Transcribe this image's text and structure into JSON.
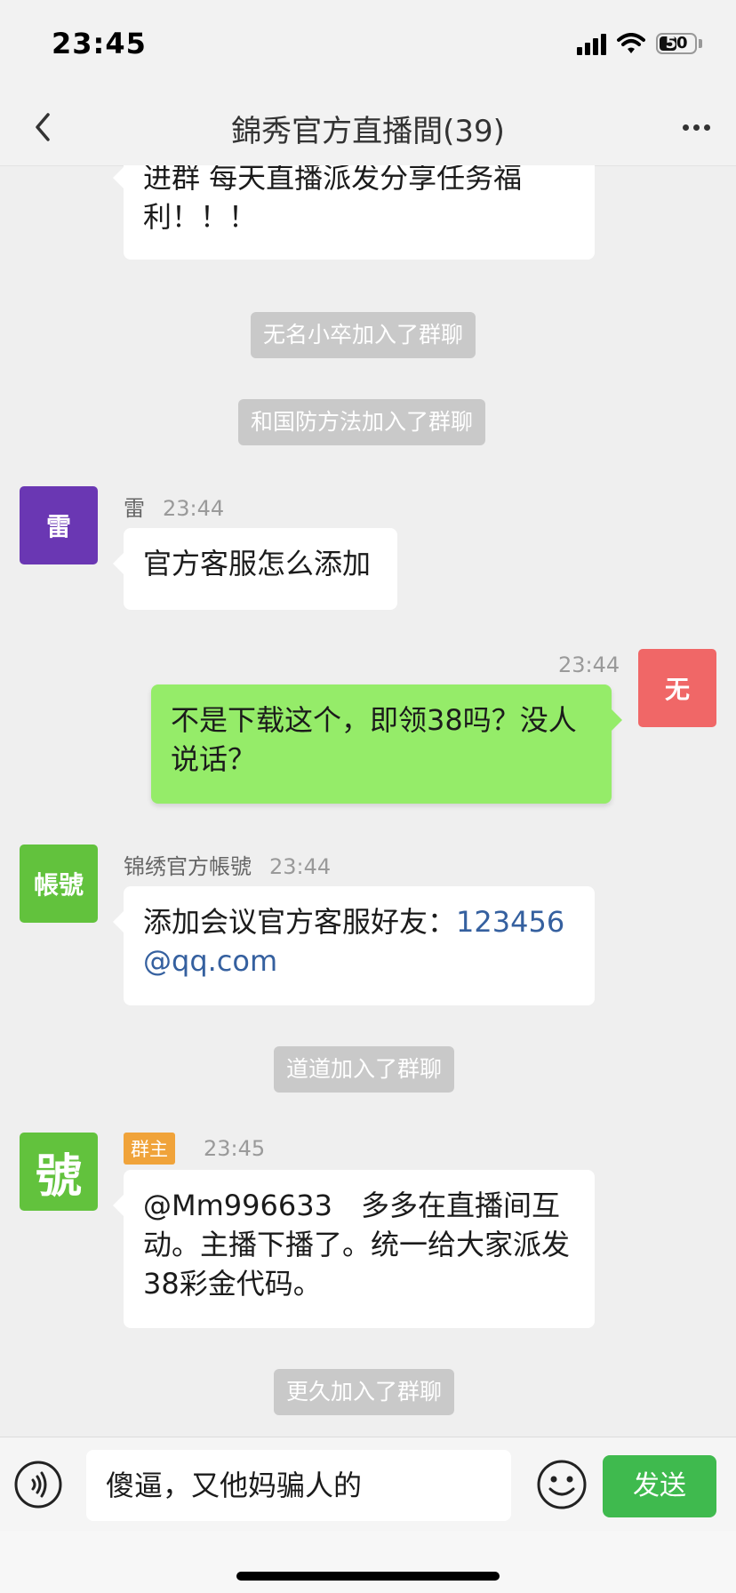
{
  "status_bar": {
    "time": "23:45",
    "battery": "50",
    "battery_level": 0.5
  },
  "nav": {
    "title": "錦秀官方直播間(39)"
  },
  "messages": {
    "m0": {
      "text": "进群 每天直播派发分享任务福利！！！"
    },
    "sys1": "无名小卒加入了群聊",
    "sys2": "和国防方法加入了群聊",
    "m1": {
      "avatar": "雷",
      "avatar_color": "#6a37b3",
      "sender": "雷",
      "time": "23:44",
      "text": "官方客服怎么添加"
    },
    "m2": {
      "avatar": "无",
      "avatar_color": "#f06767",
      "time": "23:44",
      "text": "不是下载这个，即领38吗？没人说话？"
    },
    "m3": {
      "avatar": "帳號",
      "avatar_color": "#62c23d",
      "sender": "锦绣官方帳號",
      "time": "23:44",
      "text": "添加会议官方客服好友：",
      "link": "123456@qq.com"
    },
    "sys3": "道道加入了群聊",
    "m4": {
      "avatar": "號",
      "avatar_color": "#62c23d",
      "badge": "群主",
      "time": "23:45",
      "text": "@Mm996633　多多在直播间互动。主播下播了。统一给大家派发38彩金代码。"
    },
    "sys4": "更久加入了群聊"
  },
  "input": {
    "value": "傻逼，又他妈骗人的",
    "send_label": "发送"
  },
  "icons": [
    "back-icon",
    "more-icon",
    "voice-icon",
    "emoji-icon",
    "signal-icon",
    "wifi-icon",
    "battery-icon"
  ]
}
